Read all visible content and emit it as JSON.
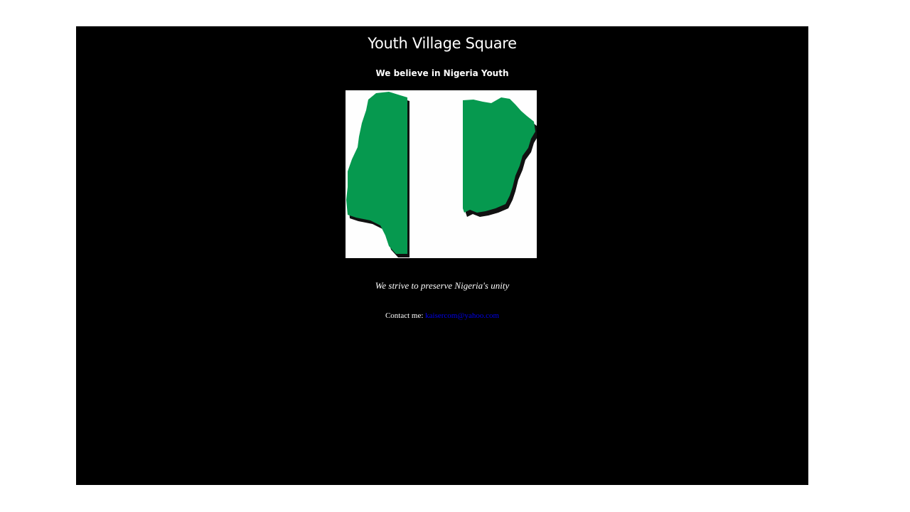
{
  "header": {
    "title": "Youth Village Square",
    "tagline": "We believe in Nigeria Youth"
  },
  "main": {
    "image": {
      "icon": "nigeria-map-flag-icon",
      "colors": {
        "green": "#06994f",
        "white": "#fefefe",
        "shadow": "#111111"
      }
    },
    "motto": "We strive to preserve Nigeria's unity",
    "contact": {
      "label": "Contact me:",
      "email": "kaisercom@yahoo.com"
    }
  },
  "colors": {
    "background": "#000000",
    "text": "#ffffff",
    "link": "#0000ee"
  }
}
